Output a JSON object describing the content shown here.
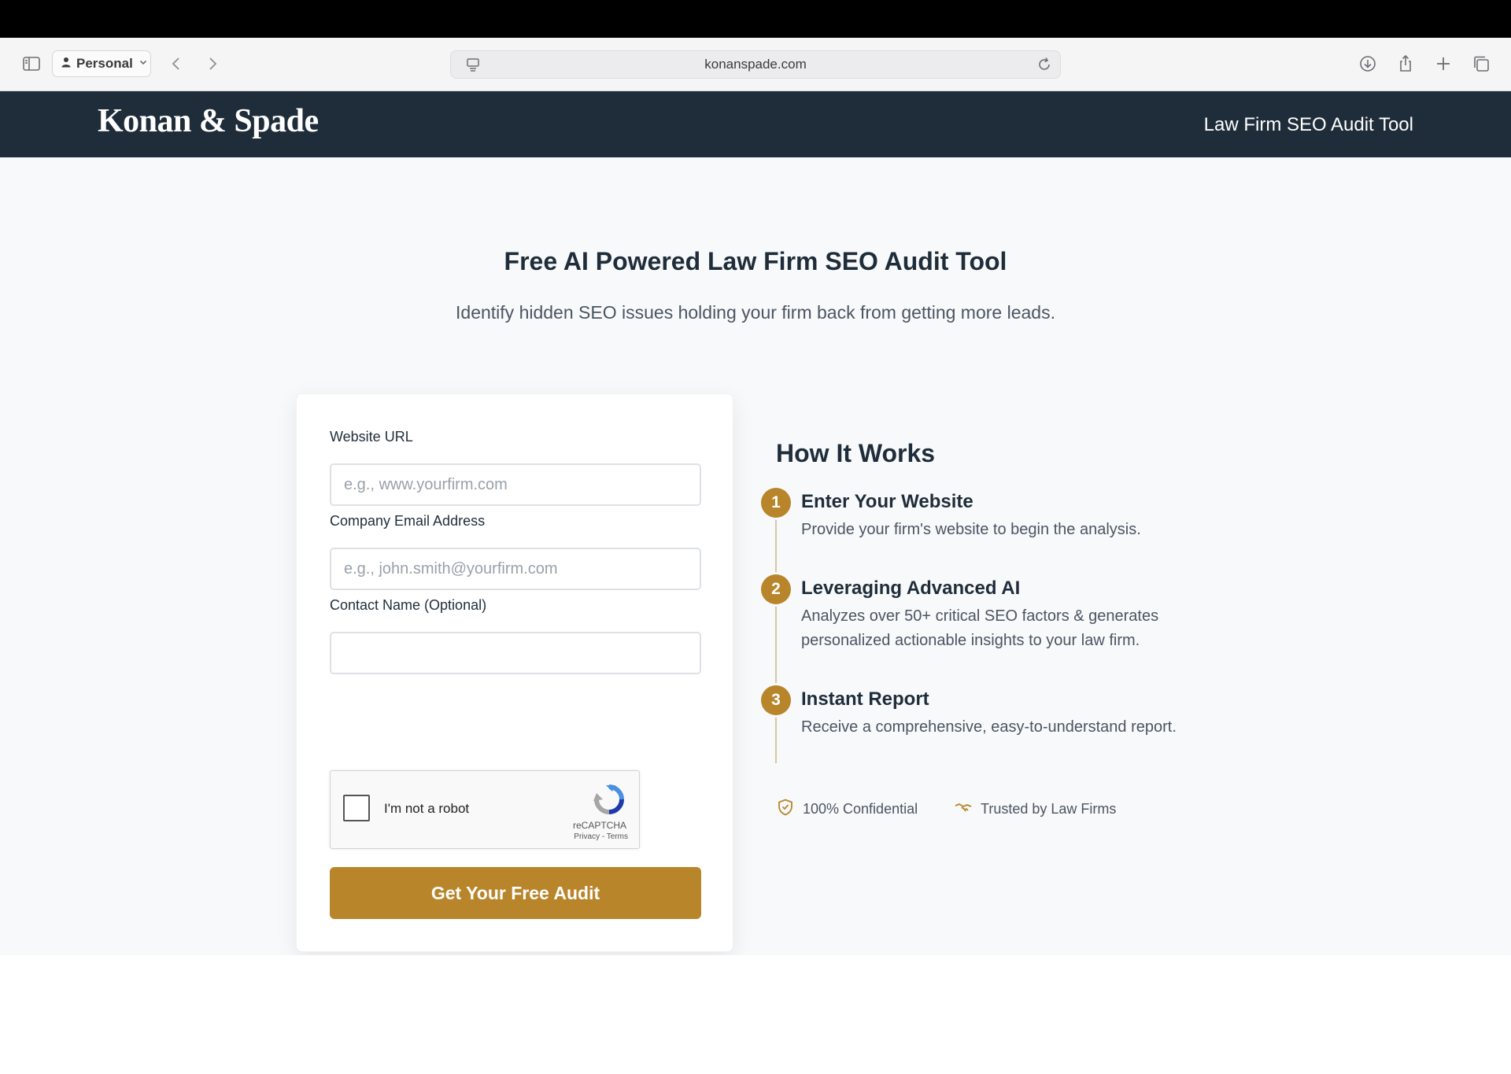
{
  "browser": {
    "profile_label": "Personal",
    "url": "konanspade.com",
    "icons": [
      "sidebar-icon",
      "person-icon",
      "chevron-down-icon",
      "back-icon",
      "forward-icon",
      "page-menu-icon",
      "reload-icon",
      "download-icon",
      "share-icon",
      "new-tab-icon",
      "tabs-overview-icon"
    ]
  },
  "header": {
    "logo": "Konan & Spade",
    "tagline": "Law Firm SEO Audit Tool"
  },
  "hero": {
    "title": "Free AI Powered Law Firm SEO Audit Tool",
    "subtitle": "Identify hidden SEO issues holding your firm back from getting more leads."
  },
  "form": {
    "website_label": "Website URL",
    "website_placeholder": "e.g., www.yourfirm.com",
    "website_value": "",
    "email_label": "Company Email Address",
    "email_placeholder": "e.g., john.smith@yourfirm.com",
    "email_value": "",
    "name_label": "Contact Name (Optional)",
    "name_placeholder": "",
    "name_value": "",
    "recaptcha_label": "I'm not a robot",
    "recaptcha_brand": "reCAPTCHA",
    "recaptcha_links": "Privacy - Terms",
    "recaptcha_checked": false,
    "submit_label": "Get Your Free Audit"
  },
  "how": {
    "title": "How It Works",
    "steps": [
      {
        "num": "1",
        "title": "Enter Your Website",
        "desc": "Provide your firm's website to begin the analysis."
      },
      {
        "num": "2",
        "title": "Leveraging Advanced AI",
        "desc": "Analyzes over 50+ critical SEO factors & generates personalized actionable insights to your law firm."
      },
      {
        "num": "3",
        "title": "Instant Report",
        "desc": "Receive a comprehensive, easy-to-understand report."
      }
    ],
    "badges": [
      {
        "label": "100% Confidential",
        "icon": "shield-check-icon"
      },
      {
        "label": "Trusted by Law Firms",
        "icon": "handshake-icon"
      }
    ]
  },
  "colors": {
    "header_bg": "#1f2d3a",
    "accent": "#b8852a",
    "page_bg": "#f8f9fb"
  }
}
